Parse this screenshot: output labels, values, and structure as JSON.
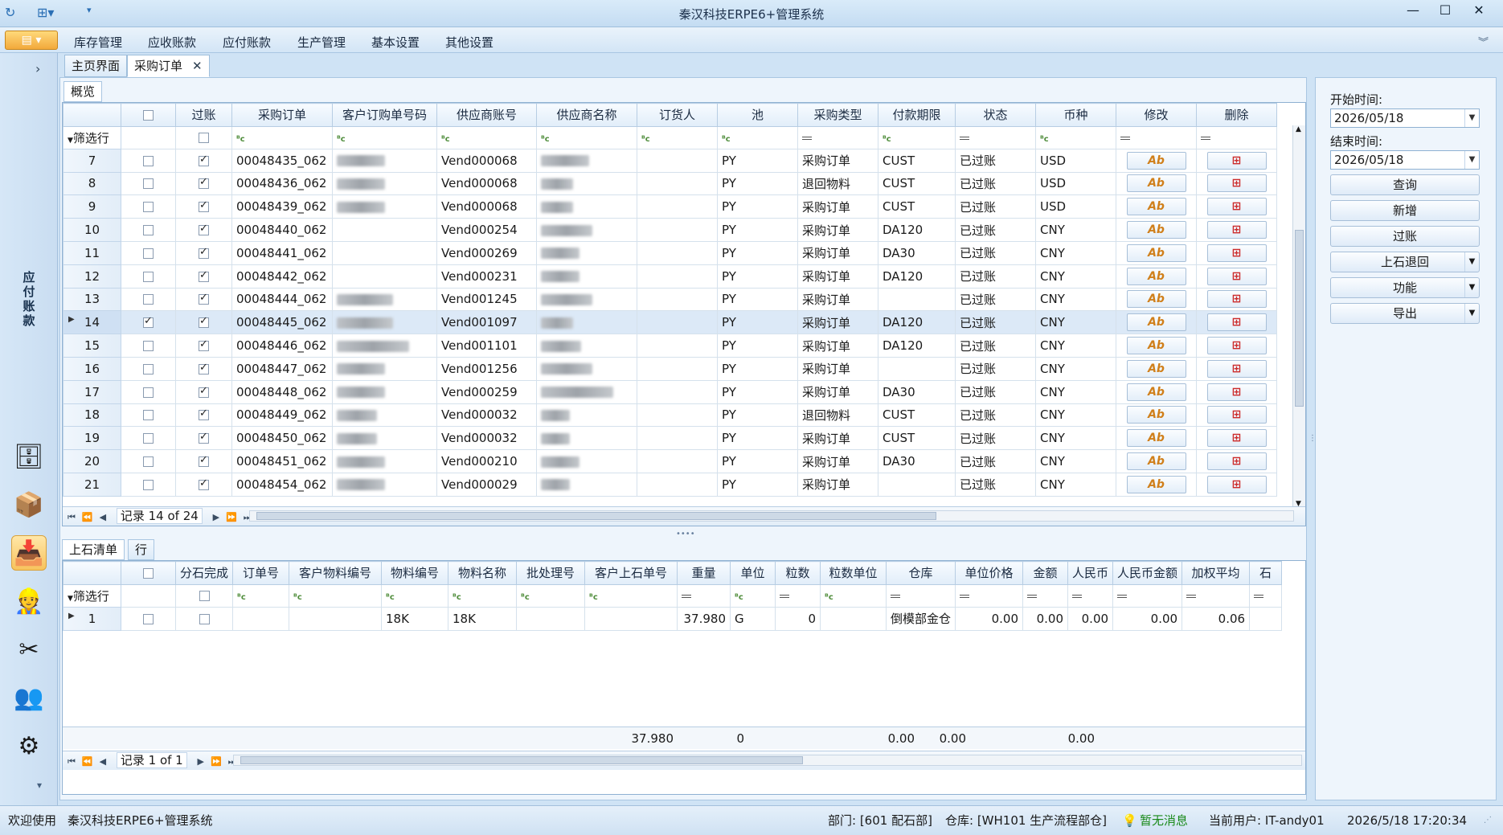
{
  "window": {
    "title": "秦汉科技ERPE6+管理系统",
    "min": "—",
    "max": "☐",
    "close": "✕"
  },
  "menu": {
    "items": [
      "库存管理",
      "应收账款",
      "应付账款",
      "生产管理",
      "基本设置",
      "其他设置"
    ]
  },
  "leftnav": {
    "vertical_title": "应付账款"
  },
  "tabs": {
    "home": "主页界面",
    "purchase": "采购订单",
    "close": "✕"
  },
  "subtab": {
    "overview": "概览"
  },
  "main_grid": {
    "filter_label": "筛选行",
    "columns": [
      "过账",
      "采购订单",
      "客户订购单号码",
      "供应商账号",
      "供应商名称",
      "订货人",
      "池",
      "采购类型",
      "付款期限",
      "状态",
      "币种",
      "修改",
      "删除"
    ],
    "rows": [
      {
        "no": "7",
        "sel": false,
        "posted": true,
        "po": "00048435_062",
        "vendor": "Vend000068",
        "pool": "PY",
        "type": "采购订单",
        "term": "CUST",
        "status": "已过账",
        "cur": "USD"
      },
      {
        "no": "8",
        "sel": false,
        "posted": true,
        "po": "00048436_062",
        "vendor": "Vend000068",
        "pool": "PY",
        "type": "退回物料",
        "term": "CUST",
        "status": "已过账",
        "cur": "USD"
      },
      {
        "no": "9",
        "sel": false,
        "posted": true,
        "po": "00048439_062",
        "vendor": "Vend000068",
        "pool": "PY",
        "type": "采购订单",
        "term": "CUST",
        "status": "已过账",
        "cur": "USD"
      },
      {
        "no": "10",
        "sel": false,
        "posted": true,
        "po": "00048440_062",
        "vendor": "Vend000254",
        "pool": "PY",
        "type": "采购订单",
        "term": "DA120",
        "status": "已过账",
        "cur": "CNY"
      },
      {
        "no": "11",
        "sel": false,
        "posted": true,
        "po": "00048441_062",
        "vendor": "Vend000269",
        "pool": "PY",
        "type": "采购订单",
        "term": "DA30",
        "status": "已过账",
        "cur": "CNY"
      },
      {
        "no": "12",
        "sel": false,
        "posted": true,
        "po": "00048442_062",
        "vendor": "Vend000231",
        "pool": "PY",
        "type": "采购订单",
        "term": "DA120",
        "status": "已过账",
        "cur": "CNY"
      },
      {
        "no": "13",
        "sel": false,
        "posted": true,
        "po": "00048444_062",
        "vendor": "Vend001245",
        "pool": "PY",
        "type": "采购订单",
        "term": "",
        "status": "已过账",
        "cur": "CNY"
      },
      {
        "no": "14",
        "sel": true,
        "posted": true,
        "po": "00048445_062",
        "vendor": "Vend001097",
        "pool": "PY",
        "type": "采购订单",
        "term": "DA120",
        "status": "已过账",
        "cur": "CNY"
      },
      {
        "no": "15",
        "sel": false,
        "posted": true,
        "po": "00048446_062",
        "vendor": "Vend001101",
        "pool": "PY",
        "type": "采购订单",
        "term": "DA120",
        "status": "已过账",
        "cur": "CNY"
      },
      {
        "no": "16",
        "sel": false,
        "posted": true,
        "po": "00048447_062",
        "vendor": "Vend001256",
        "pool": "PY",
        "type": "采购订单",
        "term": "",
        "status": "已过账",
        "cur": "CNY"
      },
      {
        "no": "17",
        "sel": false,
        "posted": true,
        "po": "00048448_062",
        "vendor": "Vend000259",
        "pool": "PY",
        "type": "采购订单",
        "term": "DA30",
        "status": "已过账",
        "cur": "CNY"
      },
      {
        "no": "18",
        "sel": false,
        "posted": true,
        "po": "00048449_062",
        "vendor": "Vend000032",
        "pool": "PY",
        "type": "退回物料",
        "term": "CUST",
        "status": "已过账",
        "cur": "CNY"
      },
      {
        "no": "19",
        "sel": false,
        "posted": true,
        "po": "00048450_062",
        "vendor": "Vend000032",
        "pool": "PY",
        "type": "采购订单",
        "term": "CUST",
        "status": "已过账",
        "cur": "CNY"
      },
      {
        "no": "20",
        "sel": false,
        "posted": true,
        "po": "00048451_062",
        "vendor": "Vend000210",
        "pool": "PY",
        "type": "采购订单",
        "term": "DA30",
        "status": "已过账",
        "cur": "CNY"
      },
      {
        "no": "21",
        "sel": false,
        "posted": true,
        "po": "00048454_062",
        "vendor": "Vend000029",
        "pool": "PY",
        "type": "采购订单",
        "term": "",
        "status": "已过账",
        "cur": "CNY"
      }
    ],
    "nav_record": "记录 14 of 24",
    "edit_icon": "Ab",
    "delete_icon": "⊞"
  },
  "detail_tabs": {
    "stone_list": "上石清单",
    "rows": "行"
  },
  "detail_grid": {
    "filter_label": "筛选行",
    "columns": [
      "分石完成",
      "订单号",
      "客户物料编号",
      "物料编号",
      "物料名称",
      "批处理号",
      "客户上石单号",
      "重量",
      "单位",
      "粒数",
      "粒数单位",
      "仓库",
      "单位价格",
      "金额",
      "人民币",
      "人民币金额",
      "加权平均",
      "石"
    ],
    "row": {
      "no": "1",
      "mat_no": "18K",
      "mat_name": "18K",
      "weight": "37.980",
      "unit": "G",
      "count": "0",
      "warehouse": "倒模部金仓",
      "price": "0.00",
      "amount": "0.00",
      "rmb": "0.00",
      "rmb_amount": "0.00",
      "wavg": "0.06"
    },
    "totals": {
      "weight": "37.980",
      "count": "0",
      "price": "0.00",
      "amount": "0.00",
      "rmb_amount": "0.00"
    },
    "nav_record": "记录 1 of 1"
  },
  "right_panel": {
    "start_label": "开始时间:",
    "start_value": "2026/05/18",
    "end_label": "结束时间:",
    "end_value": "2026/05/18",
    "buttons": [
      "查询",
      "新增",
      "过账",
      "上石退回",
      "功能",
      "导出"
    ]
  },
  "status": {
    "welcome": "欢迎使用",
    "app": "秦汉科技ERPE6+管理系统",
    "dept": "部门: [601 配石部]",
    "warehouse": "仓库: [WH101 生产流程部仓]",
    "message": "暂无消息",
    "user": "当前用户: IT-andy01",
    "datetime": "2026/5/18 17:20:34"
  }
}
